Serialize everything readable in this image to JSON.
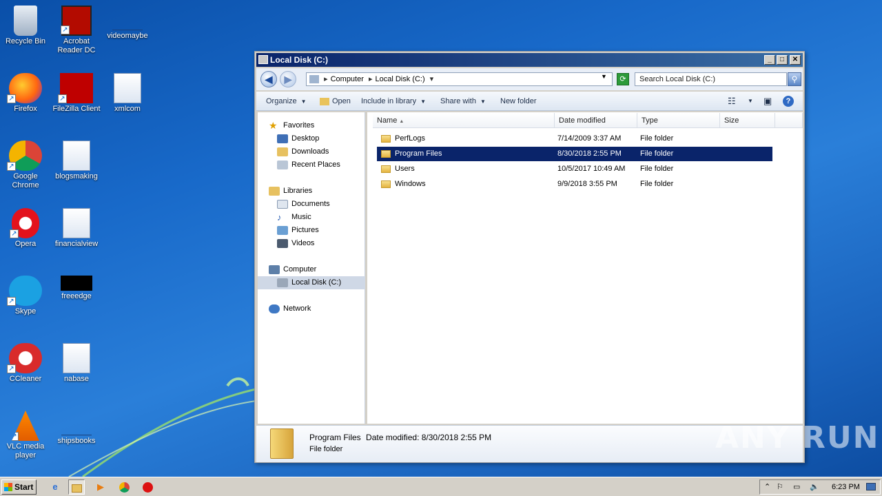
{
  "desktop": {
    "icons": [
      {
        "label": "Recycle Bin",
        "icon": "recycle-bin-icon"
      },
      {
        "label": "Acrobat Reader DC",
        "icon": "acrobat-icon"
      },
      {
        "label": "videomaybe",
        "icon": "blank-file-icon"
      },
      {
        "label": "Firefox",
        "icon": "firefox-icon"
      },
      {
        "label": "FileZilla Client",
        "icon": "filezilla-icon"
      },
      {
        "label": "xmlcom",
        "icon": "word-doc-icon"
      },
      {
        "label": "Google Chrome",
        "icon": "chrome-icon"
      },
      {
        "label": "blogsmaking",
        "icon": "word-doc-icon"
      },
      {
        "label": "Opera",
        "icon": "opera-icon"
      },
      {
        "label": "financialview",
        "icon": "word-doc-icon"
      },
      {
        "label": "Skype",
        "icon": "skype-icon"
      },
      {
        "label": "freeedge",
        "icon": "black-file-icon"
      },
      {
        "label": "CCleaner",
        "icon": "ccleaner-icon"
      },
      {
        "label": "nabase",
        "icon": "word-doc-icon"
      },
      {
        "label": "VLC media player",
        "icon": "vlc-icon"
      },
      {
        "label": "shipsbooks",
        "icon": "blank-file-icon"
      }
    ]
  },
  "window": {
    "title": "Local Disk (C:)",
    "buttons": {
      "min": "_",
      "max": "□",
      "close": "✕"
    },
    "breadcrumb": [
      "Computer",
      "Local Disk (C:)"
    ],
    "search_placeholder": "Search Local Disk (C:)",
    "commands": {
      "organize": "Organize",
      "open": "Open",
      "include": "Include in library",
      "share": "Share with",
      "newfolder": "New folder"
    },
    "nav": {
      "favorites": "Favorites",
      "desktop": "Desktop",
      "downloads": "Downloads",
      "recent": "Recent Places",
      "libraries": "Libraries",
      "documents": "Documents",
      "music": "Music",
      "pictures": "Pictures",
      "videos": "Videos",
      "computer": "Computer",
      "localdisk": "Local Disk (C:)",
      "network": "Network"
    },
    "columns": {
      "name": "Name",
      "date": "Date modified",
      "type": "Type",
      "size": "Size"
    },
    "files": [
      {
        "name": "PerfLogs",
        "date": "7/14/2009 3:37 AM",
        "type": "File folder"
      },
      {
        "name": "Program Files",
        "date": "8/30/2018 2:55 PM",
        "type": "File folder"
      },
      {
        "name": "Users",
        "date": "10/5/2017 10:49 AM",
        "type": "File folder"
      },
      {
        "name": "Windows",
        "date": "9/9/2018 3:55 PM",
        "type": "File folder"
      }
    ],
    "details": {
      "name": "Program Files",
      "date_label": "Date modified:",
      "date": "8/30/2018 2:55 PM",
      "type": "File folder"
    }
  },
  "taskbar": {
    "start": "Start",
    "clock": "6:23 PM"
  },
  "watermark": "ANY RUN"
}
